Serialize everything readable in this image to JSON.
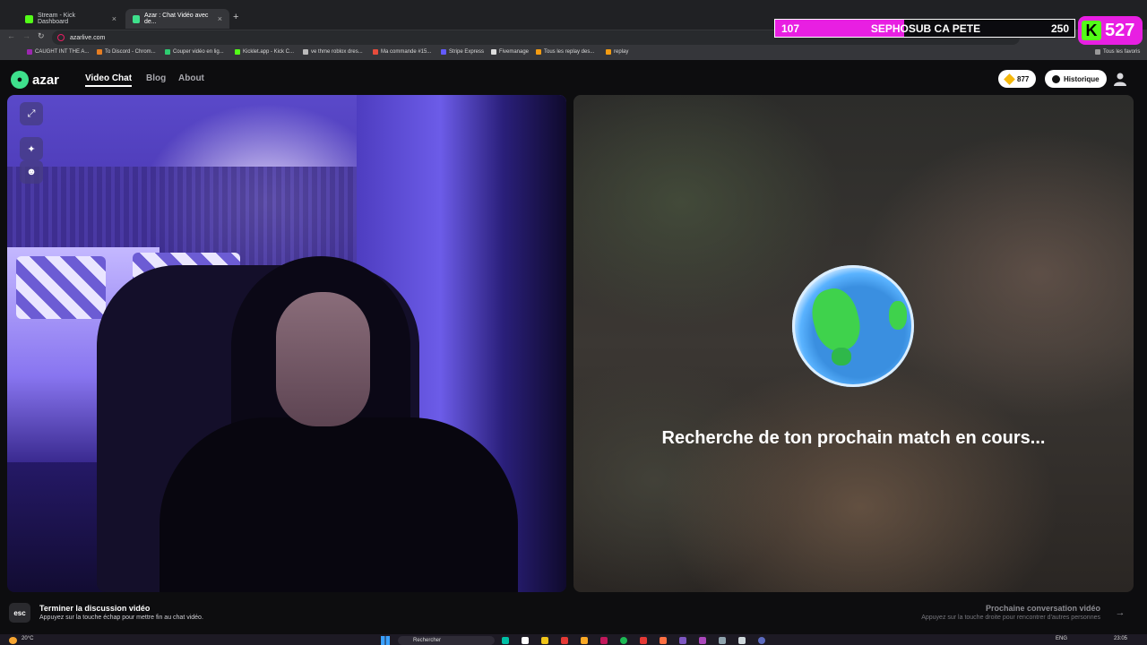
{
  "browser": {
    "tabs": [
      {
        "title": "Stream - Kick Dashboard"
      },
      {
        "title": "Azar : Chat Vidéo avec de..."
      }
    ],
    "url": "azarlive.com",
    "bookmarks": [
      "CAUGHT INT THE A...",
      "To Discord - Chrom...",
      "Couper vidéo en lig...",
      "Kicklet.app - Kick C...",
      "ve thme roblox dres...",
      "Ma commande #15...",
      "Stripe Express",
      "Fivemanage",
      "Tous les replay des...",
      "replay"
    ],
    "all_bookmarks_label": "Tous les favoris"
  },
  "overlay": {
    "sub_current": "107",
    "sub_title": "SEPHOSUB CA PETE",
    "sub_goal": "250",
    "sub_progress": 0.43,
    "kick_letter": "K",
    "kick_count": "527",
    "accent": "#e81fe2",
    "kick_green": "#53fc18"
  },
  "app": {
    "logo_text": "azar",
    "nav": [
      "Video Chat",
      "Blog",
      "About"
    ],
    "gems": "877",
    "history_label": "Historique",
    "icons": {
      "expand": "expand-icon",
      "effects": "sparkle-icon",
      "face_filter": "face-icon",
      "profile": "user-icon"
    }
  },
  "match": {
    "searching_text": "Recherche de ton prochain match en cours..."
  },
  "footer": {
    "esc_key": "esc",
    "end_title": "Terminer la discussion vidéo",
    "end_hint": "Appuyez sur la touche échap pour mettre fin au chat vidéo.",
    "next_title": "Prochaine conversation vidéo",
    "next_hint": "Appuyez sur la touche droite pour rencontrer d'autres personnes"
  },
  "taskbar": {
    "temperature": "20°C",
    "search_placeholder": "Rechercher",
    "language": "ENG",
    "time": "23:05"
  }
}
